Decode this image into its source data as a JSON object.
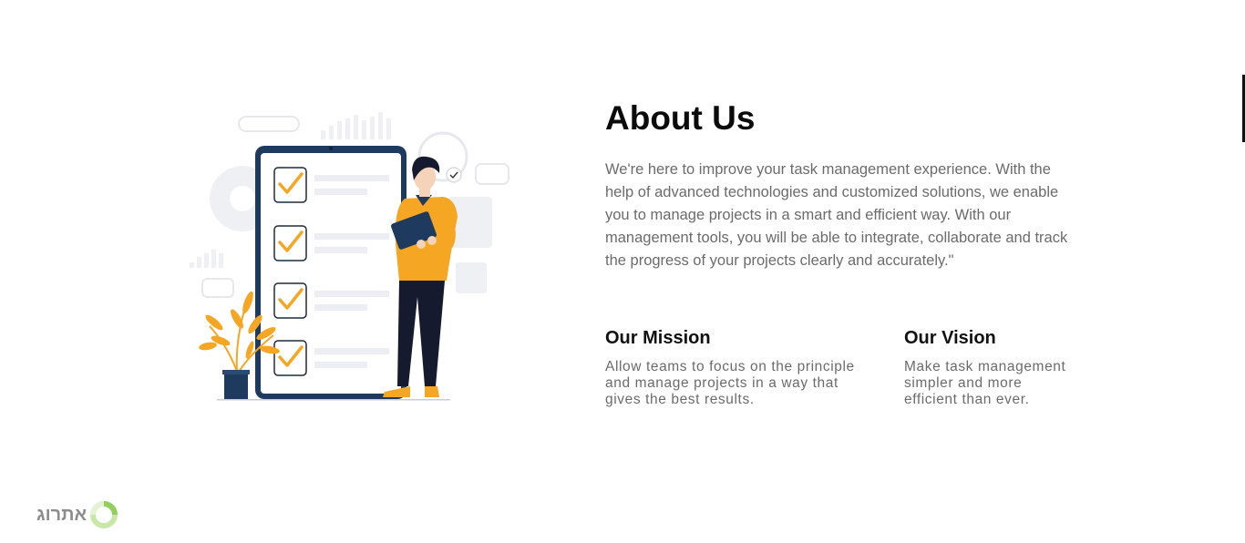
{
  "about": {
    "title": "About Us",
    "intro": "We're here to improve your task management experience. With the help of advanced technologies and customized solutions, we enable you to manage projects in a smart and efficient way. With our management tools, you will be able to integrate, collaborate and track the progress of your projects clearly and accurately.\""
  },
  "mission": {
    "title": "Our Mission",
    "text": "Allow teams to focus on the principle and manage projects in a way that gives the best results."
  },
  "vision": {
    "title": "Our Vision",
    "text": "Make task management simpler and more efficient than ever."
  },
  "brand": {
    "name": "אתרוג",
    "icon": "ring-logo-icon"
  },
  "colors": {
    "accent": "#f5a623",
    "navy": "#1f3a5f",
    "text_gray": "#6b6b6b"
  }
}
